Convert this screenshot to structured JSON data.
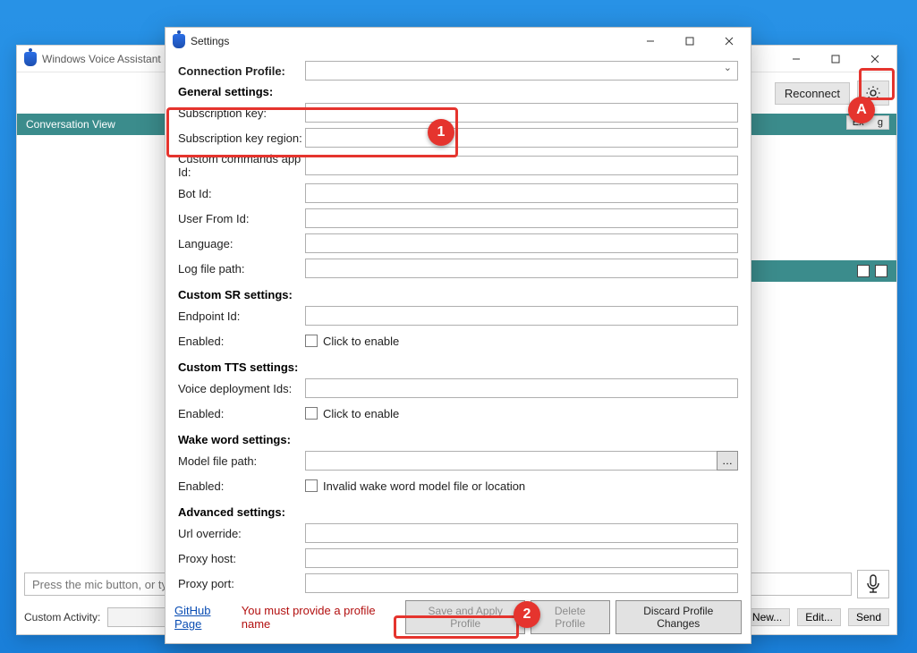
{
  "bgWindow": {
    "title": "Windows Voice Assistant",
    "reconnect": "Reconnect",
    "convHeader": "Conversation View",
    "exportBtn": "Ex",
    "exportSuffix": "g",
    "placeholder": "Press the mic button, or typ",
    "customActivity": "Custom Activity:",
    "newBtn": "New...",
    "editBtn": "Edit...",
    "sendBtn": "Send"
  },
  "settings": {
    "title": "Settings",
    "connectionProfile": "Connection Profile:",
    "generalHdr": "General settings:",
    "rows": {
      "subKey": "Subscription key:",
      "subRegion": "Subscription key region:",
      "appId": "Custom commands app Id:",
      "botId": "Bot Id:",
      "userFrom": "User From Id:",
      "language": "Language:",
      "logPath": "Log file path:"
    },
    "srHdr": "Custom SR settings:",
    "sr": {
      "endpoint": "Endpoint Id:",
      "enabled": "Enabled:",
      "chk": "Click to enable"
    },
    "ttsHdr": "Custom TTS settings:",
    "tts": {
      "voice": "Voice deployment Ids:",
      "enabled": "Enabled:",
      "chk": "Click to enable"
    },
    "wakeHdr": "Wake word settings:",
    "wake": {
      "model": "Model file path:",
      "enabled": "Enabled:",
      "chk": "Invalid wake word model file or location"
    },
    "advHdr": "Advanced settings:",
    "adv": {
      "url": "Url override:",
      "proxyHost": "Proxy host:",
      "proxyPort": "Proxy port:"
    },
    "footer": {
      "github": "GitHub Page",
      "warn": "You must provide a profile name",
      "save": "Save and Apply Profile",
      "delete": "Delete Profile",
      "discard": "Discard Profile Changes"
    }
  },
  "annotations": {
    "badge1": "1",
    "badge2": "2",
    "badgeA": "A"
  }
}
